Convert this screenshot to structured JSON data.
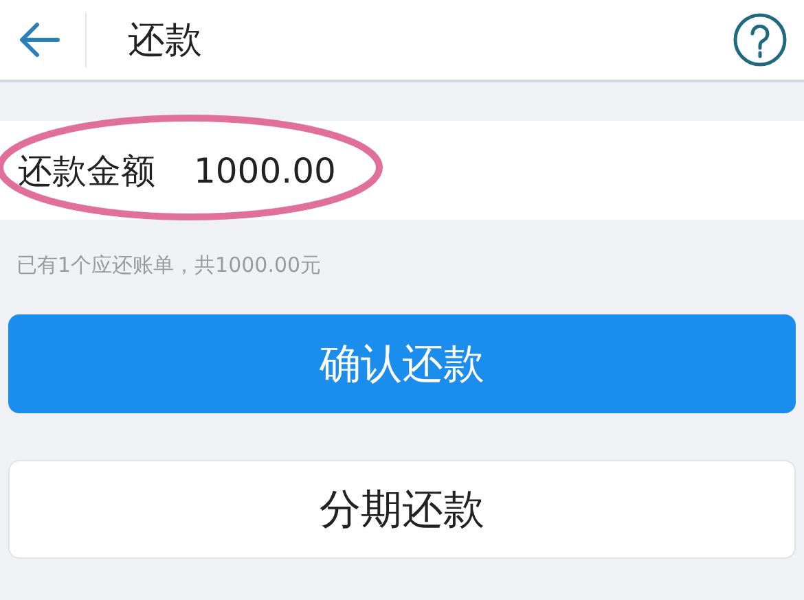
{
  "header": {
    "title": "还款"
  },
  "amount_row": {
    "label": "还款金额",
    "value": "1000.00",
    "circled": true
  },
  "hint": "已有1个应还账单，共1000.00元",
  "buttons": [
    {
      "label": "确认还款",
      "kind": "primary"
    },
    {
      "label": "分期还款",
      "kind": "secondary"
    }
  ]
}
